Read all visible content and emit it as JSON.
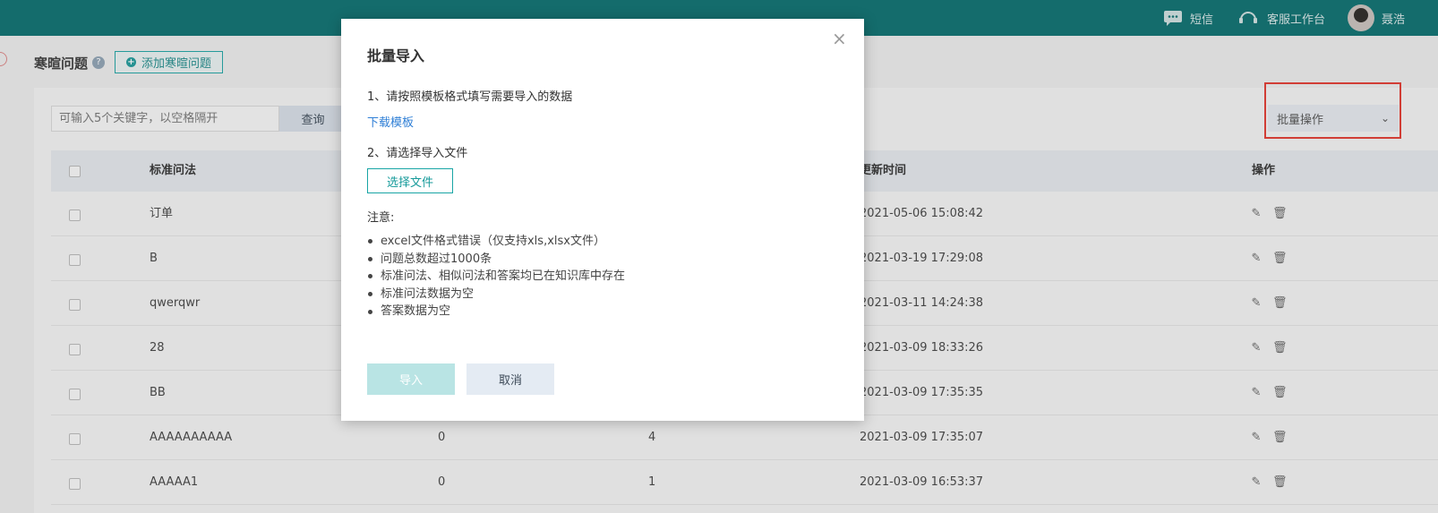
{
  "topbar": {
    "sms_label": "短信",
    "workbench_label": "客服工作台",
    "user_name": "聂浩"
  },
  "page": {
    "title": "寒暄问题",
    "help_glyph": "?",
    "add_button": "添加寒暄问题",
    "add_glyph": "+"
  },
  "toolbar": {
    "search_placeholder": "可输入5个关键字，以空格隔开",
    "search_button": "查询",
    "batch_select": "批量操作",
    "batch_caret": "⌄"
  },
  "table": {
    "headers": [
      "标准问法",
      "更新时间",
      "操作"
    ],
    "rows": [
      {
        "question": "订单",
        "c2": "",
        "c3": "",
        "updated": "2021-05-06 15:08:42"
      },
      {
        "question": "B",
        "c2": "",
        "c3": "",
        "updated": "2021-03-19 17:29:08"
      },
      {
        "question": "qwerqwr",
        "c2": "",
        "c3": "",
        "updated": "2021-03-11 14:24:38"
      },
      {
        "question": "28",
        "c2": "",
        "c3": "",
        "updated": "2021-03-09 18:33:26"
      },
      {
        "question": "BB",
        "c2": "",
        "c3": "",
        "updated": "2021-03-09 17:35:35"
      },
      {
        "question": "AAAAAAAAAA",
        "c2": "0",
        "c3": "4",
        "updated": "2021-03-09 17:35:07"
      },
      {
        "question": "AAAAA1",
        "c2": "0",
        "c3": "1",
        "updated": "2021-03-09 16:53:37"
      }
    ],
    "edit_glyph": "✎",
    "delete_glyph": "🗑"
  },
  "modal": {
    "title": "批量导入",
    "close_glyph": "×",
    "step1": "1、请按照模板格式填写需要导入的数据",
    "download_link": "下载模板",
    "step2": "2、请选择导入文件",
    "choose_file": "选择文件",
    "note_title": "注意:",
    "notes": [
      "excel文件格式错误（仅支持xls,xlsx文件）",
      "问题总数超过1000条",
      "标准问法、相似问法和答案均已在知识库中存在",
      "标准问法数据为空",
      "答案数据为空"
    ],
    "import_button": "导入",
    "cancel_button": "取消"
  },
  "colors": {
    "topbar": "#0b6f6f",
    "accent": "#18a5a5",
    "link": "#2f7fd6",
    "highlight": "#e23a30"
  }
}
